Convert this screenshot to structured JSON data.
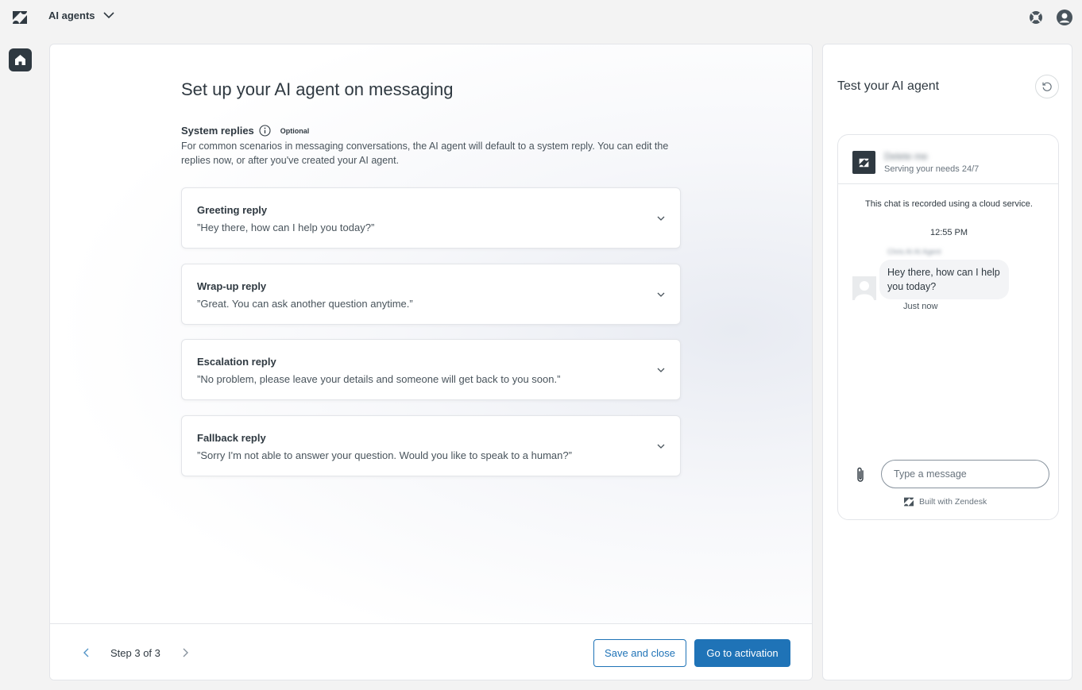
{
  "header": {
    "product_name": "AI agents",
    "icons": [
      "zendesk-logo-icon",
      "chevron-down-icon",
      "help-lifebuoy-icon",
      "profile-avatar-icon"
    ]
  },
  "nav": {
    "home_icon": "home-icon"
  },
  "main": {
    "title": "Set up your AI agent on messaging",
    "section_title": "System replies",
    "optional_badge": "Optional",
    "section_desc": "For common scenarios in messaging conversations, the AI agent will default to a system reply. You can edit the replies now, or after you've created your AI agent.",
    "replies": [
      {
        "title": "Greeting reply",
        "text": "”Hey there, how can I help you today?”"
      },
      {
        "title": "Wrap-up reply",
        "text": "”Great. You can ask another question anytime.”"
      },
      {
        "title": "Escalation reply",
        "text": "”No problem, please leave your details and someone will get back to you soon.”"
      },
      {
        "title": "Fallback reply",
        "text": "”Sorry I'm not able to answer your question. Would you like to speak to a human?”"
      }
    ]
  },
  "footer": {
    "step_label": "Step 3 of 3",
    "save_label": "Save and close",
    "go_label": "Go to activation"
  },
  "test_panel": {
    "title": "Test your AI agent",
    "widget": {
      "name": "Delete me",
      "subtitle": "Serving your needs 24/7",
      "recorded_note": "This chat is recorded using a cloud service.",
      "time": "12:55 PM",
      "bot_name": "Chris AI AI Agent",
      "bot_message": "Hey there, how can I help you today?",
      "message_status": "Just now",
      "input_placeholder": "Type a message",
      "built_with": "Built with Zendesk"
    }
  },
  "colors": {
    "accent": "#1f73b7",
    "dark": "#2f3941",
    "background": "#f3f3f3",
    "border": "#e3e5e9"
  }
}
